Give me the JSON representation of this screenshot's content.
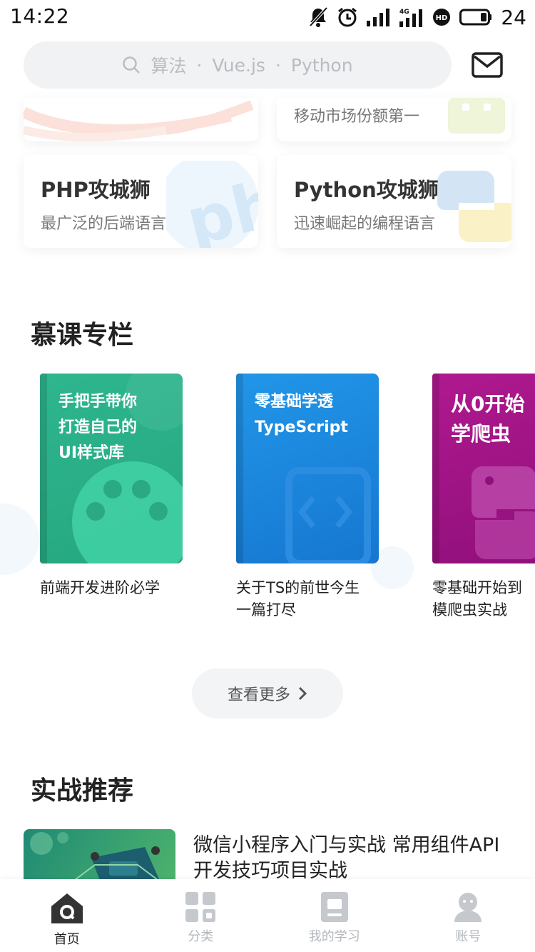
{
  "status_bar": {
    "time": "14:22",
    "battery": "24",
    "network": "4G"
  },
  "search": {
    "items": [
      "算法",
      "·",
      "Vue.js",
      "·",
      "Python"
    ]
  },
  "top_cards": [
    {
      "title": "",
      "subtitle": "移动市场份额第一"
    },
    {
      "title": "PHP攻城狮",
      "subtitle": "最广泛的后端语言"
    },
    {
      "title": "Python攻城狮",
      "subtitle": "迅速崛起的编程语言"
    }
  ],
  "column_section": {
    "title": "慕课专栏",
    "books": [
      {
        "cover_text": "手把手带你\n打造自己的\nUI样式库",
        "caption": "前端开发进阶必学",
        "color": "#2bb58c"
      },
      {
        "cover_text": "零基础学透\nTypeScript",
        "caption": "关于TS的前世今生\n一篇打尽",
        "color": "#1e82d8"
      },
      {
        "cover_text": "从0开始\n学爬虫",
        "caption": "零基础开始到\n模爬虫实战",
        "color": "#a0148a"
      }
    ],
    "more_label": "查看更多"
  },
  "practice_section": {
    "title": "实战推荐",
    "course_title": "微信小程序入门与实战 常用组件API开发技巧项目实战"
  },
  "tabs": [
    {
      "label": "首页",
      "icon": "home-icon",
      "active": true
    },
    {
      "label": "分类",
      "icon": "grid-icon",
      "active": false
    },
    {
      "label": "我的学习",
      "icon": "book-icon",
      "active": false
    },
    {
      "label": "账号",
      "icon": "user-icon",
      "active": false
    }
  ]
}
